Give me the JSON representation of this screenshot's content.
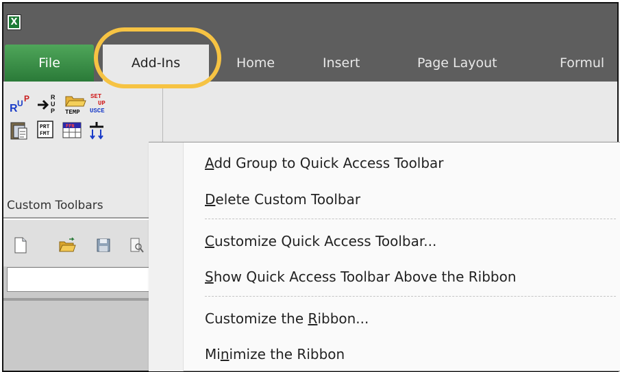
{
  "app": {
    "logo_letter": "X",
    "window_border_color": "#111111",
    "highlight_color": "#f6c343"
  },
  "tabs": [
    {
      "label": "File",
      "state": "file-tab"
    },
    {
      "label": "Add-Ins",
      "state": "selected"
    },
    {
      "label": "Home"
    },
    {
      "label": "Insert"
    },
    {
      "label": "Page Layout"
    },
    {
      "label": "Formul"
    }
  ],
  "ribbon": {
    "group_label": "Custom Toolbars",
    "buttons": [
      "rup-icon",
      "arrow-rup-icon",
      "temp-folder-icon",
      "setup-usce-icon",
      "clipboard-icon",
      "prt-fmt-icon",
      "ffn-grid-icon",
      "split-arrows-icon"
    ]
  },
  "quick_access": {
    "icons": [
      "new-document-icon",
      "open-folder-icon",
      "save-icon",
      "print-preview-icon"
    ]
  },
  "context_menu": {
    "items": [
      {
        "prefix": "",
        "key": "A",
        "rest": "dd Group to Quick Access Toolbar"
      },
      {
        "prefix": "",
        "key": "D",
        "rest": "elete Custom Toolbar"
      },
      {
        "prefix": "",
        "key": "C",
        "rest": "ustomize Quick Access Toolbar..."
      },
      {
        "prefix": "",
        "key": "S",
        "rest": "how Quick Access Toolbar Above the Ribbon"
      },
      {
        "prefix": "Customize the ",
        "key": "R",
        "rest": "ibbon..."
      },
      {
        "prefix": "Mi",
        "key": "n",
        "rest": "imize the Ribbon"
      }
    ]
  }
}
